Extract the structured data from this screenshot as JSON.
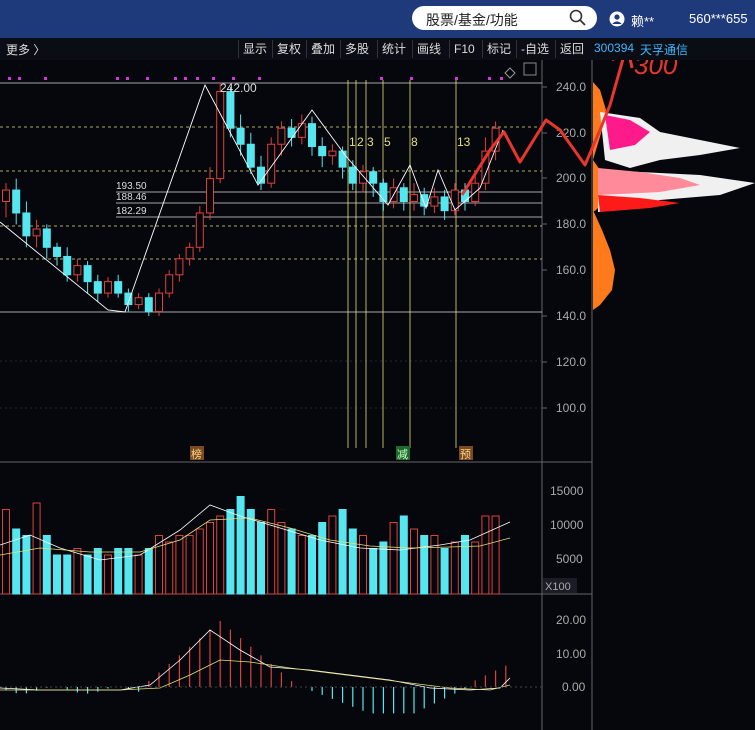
{
  "search": {
    "placeholder": "股票/基金/功能"
  },
  "user": {
    "name": "赖**",
    "id": "560***655"
  },
  "toolbar": {
    "more": "更多 〉",
    "buttons": [
      "显示",
      "复权",
      "叠加",
      "多股",
      "统计",
      "画线",
      "F10",
      "标记",
      "-自选",
      "返回"
    ]
  },
  "stock": {
    "code": "300394",
    "name": "天孚通信"
  },
  "price_axis": {
    "ticks": [
      "240.0",
      "220.0",
      "200.0",
      "180.0",
      "160.0",
      "140.0",
      "120.0",
      "100.0"
    ]
  },
  "volume_axis": {
    "ticks": [
      "15000",
      "10000",
      "5000"
    ],
    "unit": "X100"
  },
  "macd_axis": {
    "ticks": [
      "20.00",
      "10.00",
      "0.00"
    ]
  },
  "annotations": {
    "high": "242.00",
    "levels": [
      "193.50",
      "188.46",
      "182.29"
    ],
    "wave_labels": [
      "1",
      "2",
      "3",
      "5",
      "8",
      "13"
    ],
    "markers": [
      "榜",
      "减",
      "预"
    ],
    "handwritten": "300"
  },
  "colors": {
    "up": "#e0403a",
    "down": "#55e6f0",
    "bg": "#05070d",
    "accent": "#3fb6ff"
  }
}
